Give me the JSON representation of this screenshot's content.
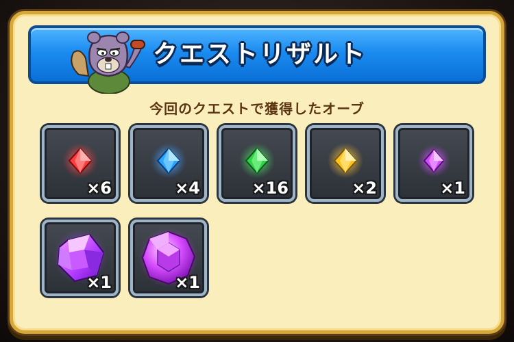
{
  "dialog": {
    "title": "クエストリザルト",
    "subtitle": "今回のクエストで獲得したオーブ"
  },
  "orbs": [
    {
      "name": "red-orb",
      "color": "#ff3b3b",
      "count": "×6"
    },
    {
      "name": "blue-orb",
      "color": "#2aa4ff",
      "count": "×4"
    },
    {
      "name": "green-orb",
      "color": "#2ed34a",
      "count": "×16"
    },
    {
      "name": "yellow-orb",
      "color": "#ffc21a",
      "count": "×2"
    },
    {
      "name": "purple-orb-small",
      "color": "#d04cff",
      "count": "×1"
    },
    {
      "name": "purple-crystal-large",
      "color": "#b84cff",
      "count": "×1"
    },
    {
      "name": "purple-orb-round-large",
      "color": "#d64cff",
      "count": "×1"
    }
  ],
  "colors": {
    "header_blue": "#1b8bf0",
    "panel_cream": "#fbeebd",
    "frame_gold": "#d6a73a",
    "slot_dark": "#3a3f46"
  }
}
